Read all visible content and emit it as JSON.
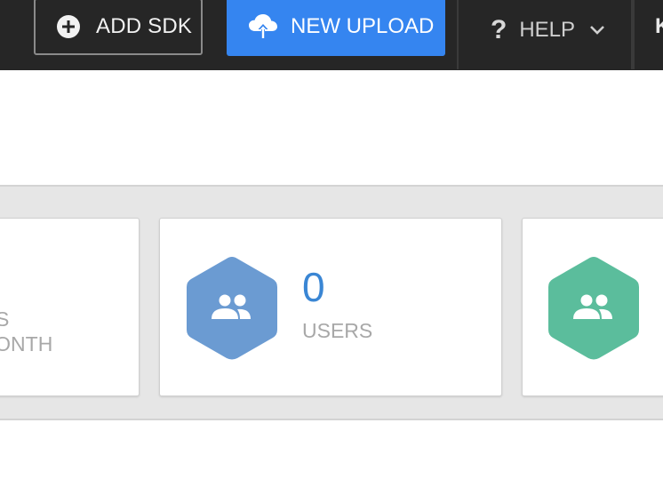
{
  "toolbar": {
    "add_sdk_label": "ADD SDK",
    "new_upload_label": "NEW UPLOAD",
    "help_label": "HELP",
    "help_mark": "?",
    "cut_menu_initial": "K"
  },
  "stats": {
    "left_card": {
      "label_line1": "S",
      "label_line2": "MONTH"
    },
    "users_card": {
      "value": "0",
      "label": "USERS",
      "hex_color": "#6b9bd2"
    },
    "right_card": {
      "hex_color": "#5bbd9c"
    }
  },
  "colors": {
    "topbar": "#262626",
    "upload_button": "#3585f0",
    "users_value": "#3a86d4"
  },
  "icons": [
    "plus-circle-icon",
    "cloud-upload-icon",
    "question-icon",
    "chevron-down-icon",
    "users-icon"
  ]
}
